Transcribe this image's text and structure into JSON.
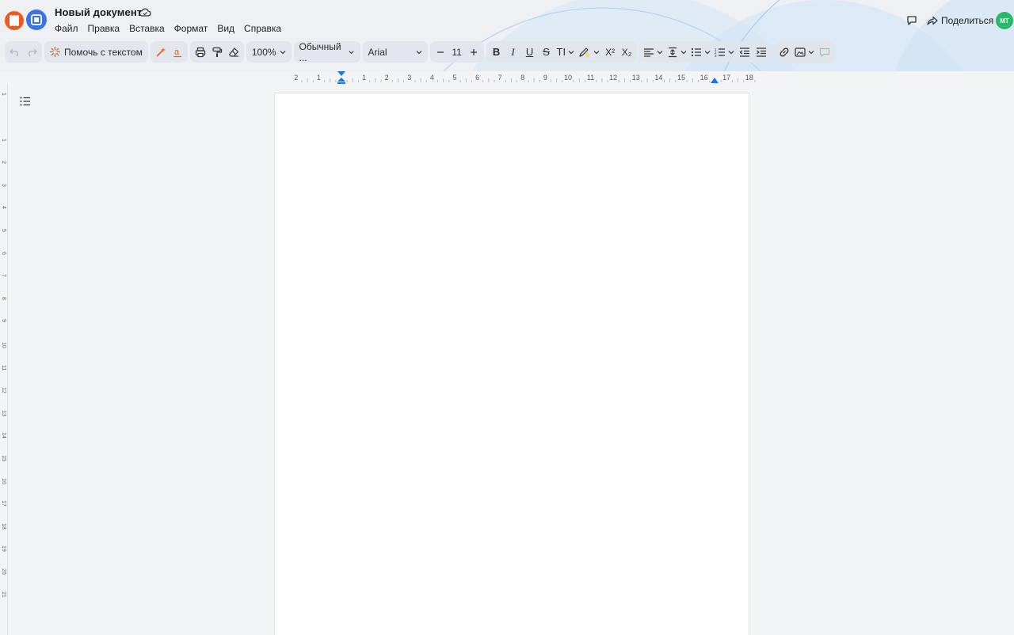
{
  "document": {
    "title": "Новый документ"
  },
  "menu": [
    "Файл",
    "Правка",
    "Вставка",
    "Формат",
    "Вид",
    "Справка"
  ],
  "header_right": {
    "share_label": "Поделиться",
    "avatar_initials": "МТ",
    "avatar_color": "#2bb86b"
  },
  "toolbar": {
    "ai_label": "Помочь с текстом",
    "zoom": "100%",
    "style": "Обычный ...",
    "font": "Arial",
    "font_size": "11",
    "bold": "B",
    "italic": "I",
    "underline": "U",
    "strike": "S",
    "text_case": "TI",
    "superscript": "X²",
    "subscript": "X₂"
  },
  "ruler": {
    "horizontal_labels": [
      "2",
      "1",
      "1",
      "2",
      "3",
      "4",
      "5",
      "6",
      "7",
      "8",
      "9",
      "10",
      "11",
      "12",
      "13",
      "14",
      "15",
      "16",
      "17",
      "18"
    ],
    "vertical_labels": [
      "2",
      "1",
      "1",
      "2",
      "3",
      "4",
      "5",
      "6",
      "7",
      "8",
      "9",
      "10",
      "11",
      "12",
      "13",
      "14",
      "15",
      "16",
      "17",
      "18",
      "19",
      "20",
      "21"
    ]
  },
  "colors": {
    "accent": "#3a73e8",
    "brand_orange": "#f05a1a",
    "ruler_marker": "#1a73e8"
  }
}
